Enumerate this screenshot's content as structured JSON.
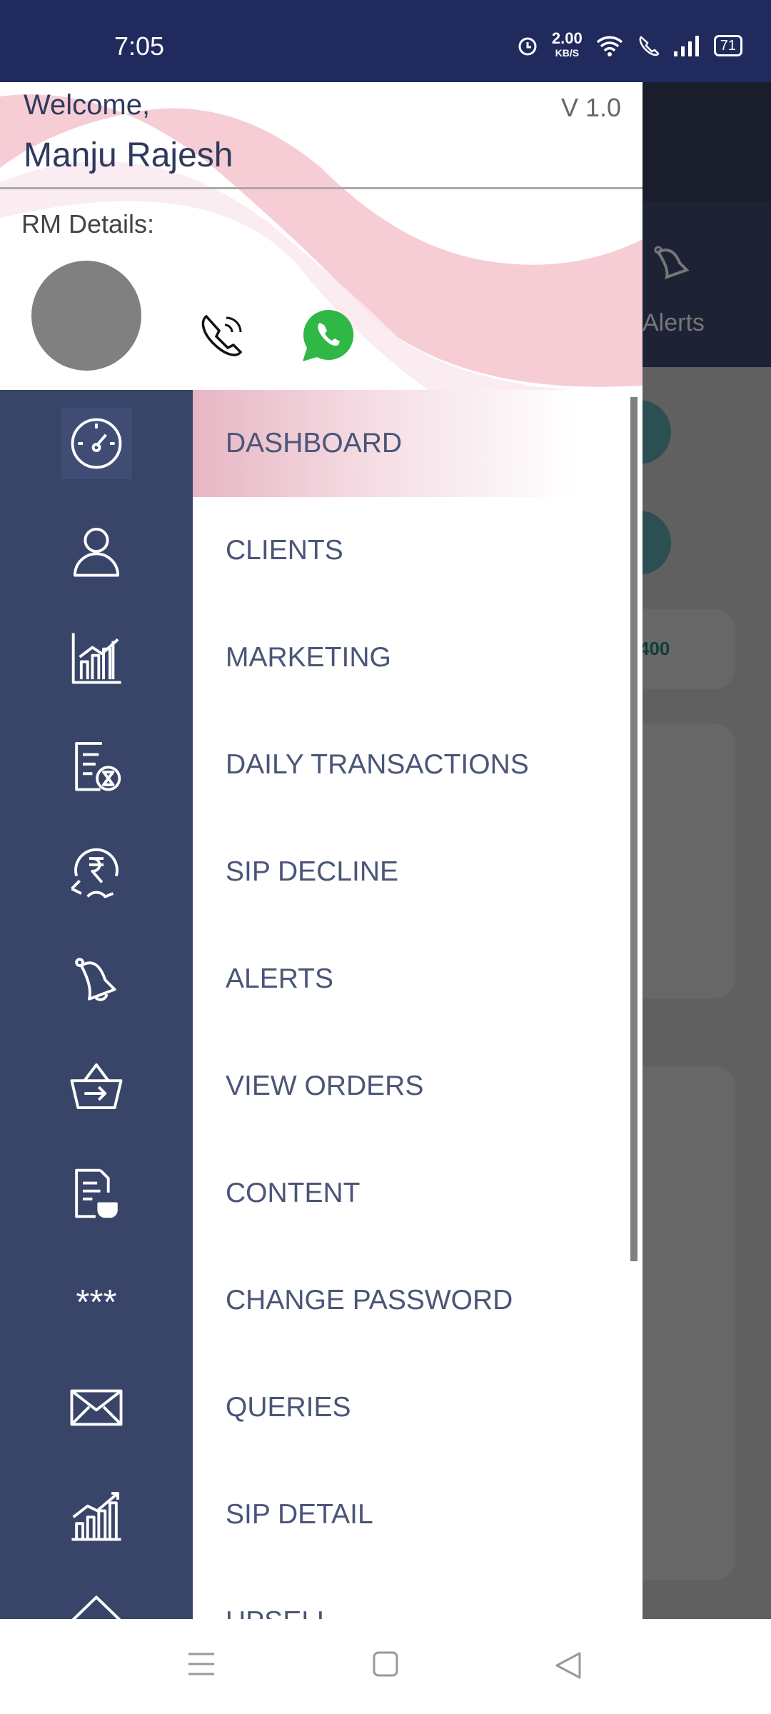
{
  "status_bar": {
    "time": "7:05",
    "net_speed": "2.00",
    "net_unit": "KB/S",
    "battery": "71"
  },
  "background": {
    "tab_label": "Alerts",
    "card_value": "400"
  },
  "drawer": {
    "welcome": "Welcome,",
    "user_name": "Manju Rajesh",
    "version": "V 1.0",
    "rm_label": "RM Details:",
    "menu": [
      {
        "label": "DASHBOARD",
        "icon": "speedometer-icon",
        "active": true
      },
      {
        "label": "CLIENTS",
        "icon": "user-icon"
      },
      {
        "label": "MARKETING",
        "icon": "bar-chart-icon"
      },
      {
        "label": "DAILY TRANSACTIONS",
        "icon": "document-hourglass-icon"
      },
      {
        "label": "SIP DECLINE",
        "icon": "rupee-decline-icon"
      },
      {
        "label": "ALERTS",
        "icon": "bell-icon"
      },
      {
        "label": "VIEW ORDERS",
        "icon": "basket-icon"
      },
      {
        "label": "CONTENT",
        "icon": "document-cup-icon"
      },
      {
        "label": "CHANGE PASSWORD",
        "icon": "password-icon"
      },
      {
        "label": "QUERIES",
        "icon": "mail-icon"
      },
      {
        "label": "SIP DETAIL",
        "icon": "growth-chart-icon"
      },
      {
        "label": "UPSELL",
        "icon": "upsell-arrow-icon"
      }
    ]
  },
  "colors": {
    "status_bar": "#202a5d",
    "rail": "#394469",
    "menu_text": "#4a5578",
    "active_highlight": "#e7b6c4"
  }
}
